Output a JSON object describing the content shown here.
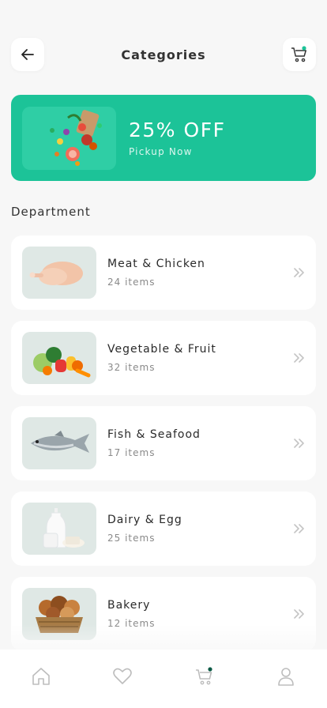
{
  "header": {
    "title": "Categories"
  },
  "promo": {
    "title": "25% OFF",
    "subtitle": "Pickup Now"
  },
  "section": {
    "title": "Department"
  },
  "categories": [
    {
      "name": "Meat & Chicken",
      "count": "24 items"
    },
    {
      "name": "Vegetable & Fruit",
      "count": "32 items"
    },
    {
      "name": "Fish & Seafood",
      "count": "17 items"
    },
    {
      "name": "Dairy & Egg",
      "count": "25 items"
    },
    {
      "name": "Bakery",
      "count": "12 items"
    }
  ],
  "colors": {
    "accent": "#1cc398",
    "nav_dot": "#0b5a45"
  },
  "icons": {
    "back": "arrow-left-icon",
    "cart": "cart-icon",
    "chevron": "double-chevron-right-icon",
    "nav": [
      "home-icon",
      "heart-icon",
      "cart-icon",
      "user-icon"
    ]
  }
}
